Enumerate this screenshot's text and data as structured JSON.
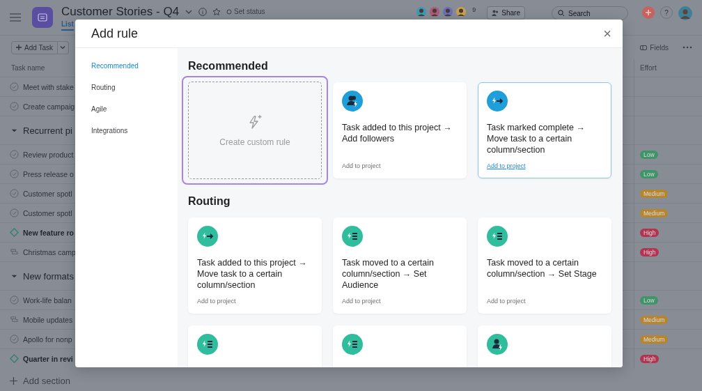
{
  "header": {
    "title": "Customer Stories - Q4",
    "status": "Set status",
    "tabs": [
      {
        "label": "List",
        "selected": true
      }
    ],
    "member_count": "9",
    "share": "Share",
    "search": {
      "placeholder": "Search"
    },
    "help": "?"
  },
  "toolbar": {
    "add_task": "Add Task",
    "fields": "Fields"
  },
  "table": {
    "columns": [
      "Task name",
      "Effort"
    ],
    "rows": [
      {
        "kind": "task",
        "name": "Meet with stake"
      },
      {
        "kind": "task",
        "name": "Create campaig"
      },
      {
        "kind": "section",
        "name": "Recurrent pi"
      },
      {
        "kind": "task",
        "name": "Review product",
        "effort": {
          "label": "Low",
          "color": "#3f9468"
        }
      },
      {
        "kind": "task",
        "name": "Press release o",
        "effort": {
          "label": "Low",
          "color": "#3f9468"
        }
      },
      {
        "kind": "task",
        "name": "Customer spotl",
        "effort": {
          "label": "Medium",
          "color": "#b5862f"
        }
      },
      {
        "kind": "task",
        "name": "Customer spotl",
        "effort": {
          "label": "Medium",
          "color": "#b5862f"
        }
      },
      {
        "kind": "milestone",
        "name": "New feature ro",
        "effort": {
          "label": "High",
          "color": "#b23450"
        }
      },
      {
        "kind": "subtask",
        "name": "Christmas camp",
        "effort": {
          "label": "High",
          "color": "#b23450"
        }
      },
      {
        "kind": "section",
        "name": "New formats"
      },
      {
        "kind": "task",
        "name": "Work-life balan",
        "effort": {
          "label": "Low",
          "color": "#3f9468"
        }
      },
      {
        "kind": "subtask",
        "name": "Mobile updates",
        "effort": {
          "label": "Medium",
          "color": "#b5862f"
        }
      },
      {
        "kind": "task",
        "name": "Apollo for nonp",
        "effort": {
          "label": "Medium",
          "color": "#b5862f"
        }
      },
      {
        "kind": "milestone",
        "name": "Quarter in revi",
        "effort": {
          "label": "High",
          "color": "#b23450"
        }
      }
    ]
  },
  "add_section": "Add section",
  "modal": {
    "title": "Add rule",
    "close": "×",
    "nav": [
      {
        "label": "Recommended",
        "selected": true
      },
      {
        "label": "Routing",
        "selected": false
      },
      {
        "label": "Agile",
        "selected": false
      },
      {
        "label": "Integrations",
        "selected": false
      }
    ],
    "sections": [
      {
        "heading": "Recommended",
        "cards": [
          {
            "kind": "custom",
            "label": "Create custom rule",
            "focused": true
          },
          {
            "kind": "followers",
            "color": "#1f9fd9",
            "title": "Task added to this project → Add followers",
            "action": "Add to project",
            "hovered": false
          },
          {
            "kind": "move",
            "color": "#1f9fd9",
            "title": "Task marked complete → Move task to a certain column/section",
            "action": "Add to project",
            "hovered": true
          }
        ]
      },
      {
        "heading": "Routing",
        "cards": [
          {
            "kind": "move",
            "color": "#2fbd9d",
            "title": "Task added to this project → Move task to a certain column/section",
            "action": "Add to project",
            "hovered": false
          },
          {
            "kind": "field",
            "color": "#2fbd9d",
            "title": "Task moved to a certain column/section → Set Audience",
            "action": "Add to project",
            "hovered": false
          },
          {
            "kind": "field",
            "color": "#2fbd9d",
            "title": "Task moved to a certain column/section → Set Stage",
            "action": "Add to project",
            "hovered": false
          },
          {
            "kind": "field",
            "color": "#2fbd9d",
            "hovered": false
          },
          {
            "kind": "field",
            "color": "#2fbd9d",
            "hovered": false
          },
          {
            "kind": "assignee",
            "color": "#2fbd9d",
            "hovered": false
          }
        ]
      }
    ]
  }
}
